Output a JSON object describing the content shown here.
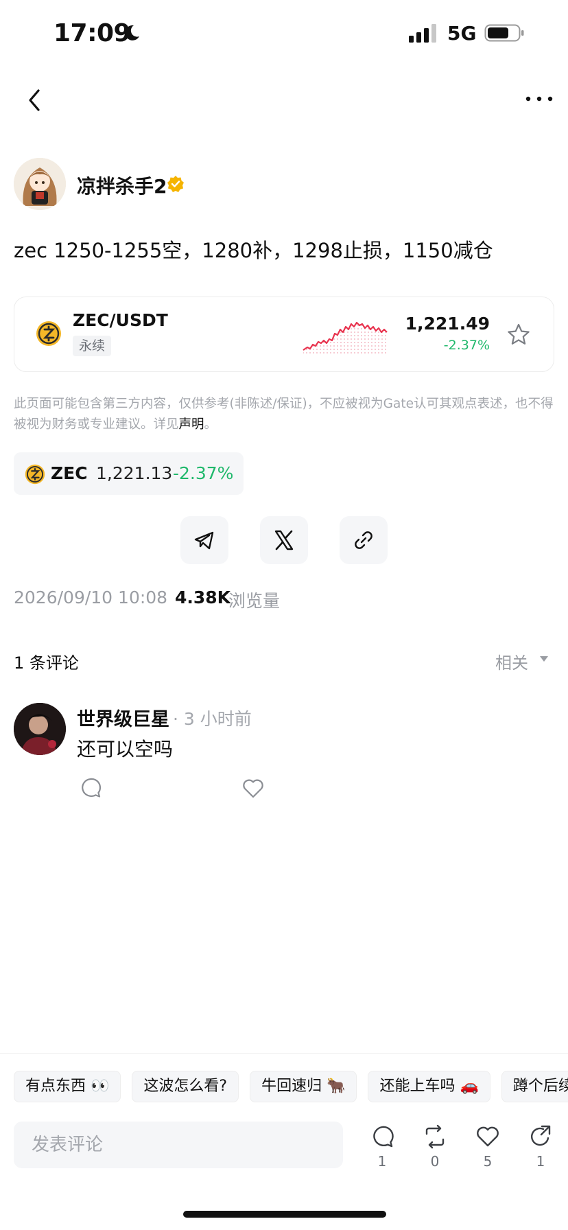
{
  "status_bar": {
    "time": "17:09",
    "network": "5G"
  },
  "author": {
    "name": "凉拌杀手2",
    "verified": true
  },
  "post": {
    "text": "zec 1250-1255空，1280补，1298止损，1150减仓"
  },
  "market_card": {
    "pair": "ZEC/USDT",
    "badge": "永续",
    "price": "1,221.49",
    "change": "-2.37%",
    "sparkline_color": "#e8334e",
    "change_color": "#1fb86b"
  },
  "disclaimer": {
    "text": "此页面可能包含第三方内容，仅供参考(非陈述/保证)，不应被视为Gate认可其观点表述，也不得被视为财务或专业建议。详见",
    "link": "声明",
    "end": "。"
  },
  "coin_tag": {
    "symbol": "ZEC",
    "price": "1,221.13",
    "change": "-2.37%"
  },
  "meta": {
    "date": "2026/09/10 10:08",
    "views": "4.38K",
    "views_label": "浏览量"
  },
  "comments": {
    "count_label": "1 条评论",
    "sort_label": "相关",
    "items": [
      {
        "user": "世界级巨星",
        "time": "· 3 小时前",
        "text": "还可以空吗"
      }
    ]
  },
  "quick_replies": [
    "有点东西 👀",
    "这波怎么看?",
    "牛回速归 🐂",
    "还能上车吗 🚗",
    "蹲个后续"
  ],
  "input": {
    "placeholder": "发表评论"
  },
  "actions": {
    "comments": "1",
    "reposts": "0",
    "likes": "5",
    "shares": "1"
  },
  "icons": {
    "back": "back-arrow-icon",
    "more": "more-dots-icon",
    "coin": "zcash-coin-icon",
    "star": "star-icon",
    "telegram": "telegram-icon",
    "x": "x-icon",
    "link": "link-icon"
  }
}
